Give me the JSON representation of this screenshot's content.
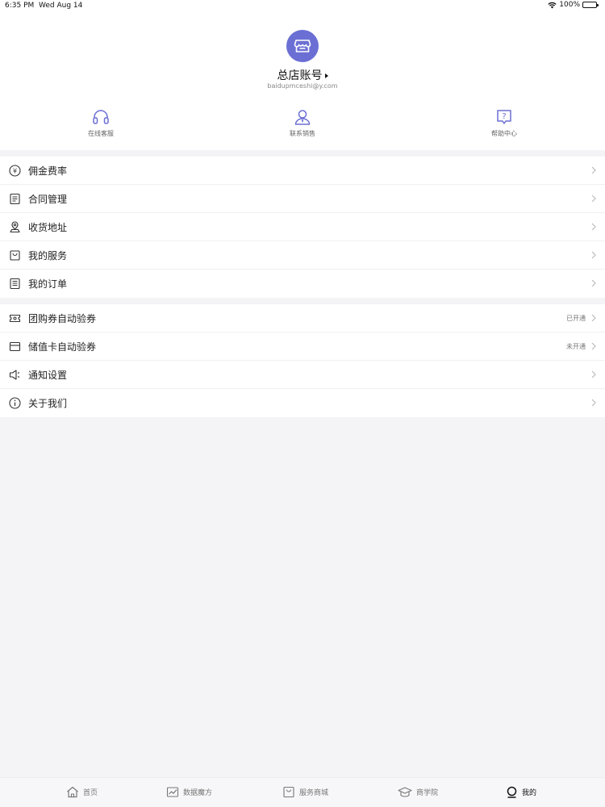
{
  "status_bar": {
    "time": "6:35 PM",
    "date": "Wed Aug 14",
    "battery": "100%"
  },
  "profile": {
    "name": "总店账号",
    "email": "baidupmceshi@y.com",
    "accent": "#6b6fd4",
    "quick_actions": [
      {
        "label": "在线客服",
        "icon": "headset-icon"
      },
      {
        "label": "联系销售",
        "icon": "salesperson-icon"
      },
      {
        "label": "帮助中心",
        "icon": "help-icon"
      }
    ]
  },
  "menu_group_1": [
    {
      "label": "佣金费率",
      "icon": "yen-icon"
    },
    {
      "label": "合同管理",
      "icon": "contract-icon"
    },
    {
      "label": "收货地址",
      "icon": "location-icon"
    },
    {
      "label": "我的服务",
      "icon": "service-bag-icon"
    },
    {
      "label": "我的订单",
      "icon": "order-list-icon"
    }
  ],
  "menu_group_2": [
    {
      "label": "团购券自动验券",
      "status": "已开通",
      "icon": "coupon-icon"
    },
    {
      "label": "储值卡自动验券",
      "status": "未开通",
      "icon": "card-icon"
    },
    {
      "label": "通知设置",
      "status": "",
      "icon": "speaker-icon"
    },
    {
      "label": "关于我们",
      "status": "",
      "icon": "info-icon"
    }
  ],
  "tabbar": [
    {
      "label": "首页",
      "icon": "home-icon"
    },
    {
      "label": "数据魔方",
      "icon": "chart-icon"
    },
    {
      "label": "服务商城",
      "icon": "shop-bag-icon"
    },
    {
      "label": "商学院",
      "icon": "graduation-cap-icon"
    },
    {
      "label": "我的",
      "icon": "profile-circle-icon",
      "active": true
    }
  ]
}
